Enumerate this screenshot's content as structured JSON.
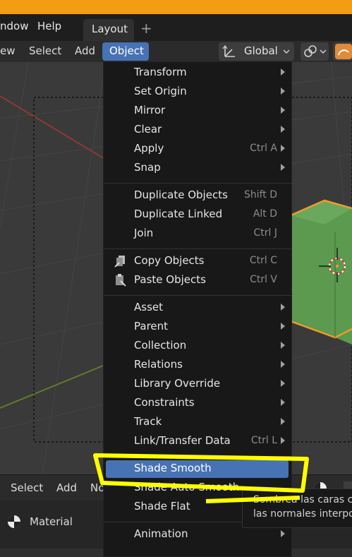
{
  "topbar": {
    "menus": [
      "ndow",
      "Help"
    ],
    "workspace_tab": "Layout",
    "add_tab_glyph": "+"
  },
  "viewport_header": {
    "menus": [
      "ew",
      "Select",
      "Add",
      "Object"
    ],
    "orientation": "Global"
  },
  "object_menu": {
    "items": [
      {
        "label": "Transform",
        "shortcut": "",
        "submenu": true
      },
      {
        "label": "Set Origin",
        "shortcut": "",
        "submenu": true
      },
      {
        "label": "Mirror",
        "shortcut": "",
        "submenu": true
      },
      {
        "label": "Clear",
        "shortcut": "",
        "submenu": true
      },
      {
        "label": "Apply",
        "shortcut": "Ctrl A",
        "submenu": true
      },
      {
        "label": "Snap",
        "shortcut": "",
        "submenu": true
      },
      {
        "label": "Duplicate Objects",
        "shortcut": "Shift D",
        "submenu": false
      },
      {
        "label": "Duplicate Linked",
        "shortcut": "Alt D",
        "submenu": false
      },
      {
        "label": "Join",
        "shortcut": "Ctrl J",
        "submenu": false
      },
      {
        "label": "Copy Objects",
        "shortcut": "Ctrl C",
        "submenu": false
      },
      {
        "label": "Paste Objects",
        "shortcut": "Ctrl V",
        "submenu": false
      },
      {
        "label": "Asset",
        "shortcut": "",
        "submenu": true
      },
      {
        "label": "Parent",
        "shortcut": "",
        "submenu": true
      },
      {
        "label": "Collection",
        "shortcut": "",
        "submenu": true
      },
      {
        "label": "Relations",
        "shortcut": "",
        "submenu": true
      },
      {
        "label": "Library Override",
        "shortcut": "",
        "submenu": true
      },
      {
        "label": "Constraints",
        "shortcut": "",
        "submenu": true
      },
      {
        "label": "Track",
        "shortcut": "",
        "submenu": true
      },
      {
        "label": "Link/Transfer Data",
        "shortcut": "Ctrl L",
        "submenu": true
      },
      {
        "label": "Shade Smooth",
        "shortcut": "",
        "submenu": false
      },
      {
        "label": "Shade Auto Smooth",
        "shortcut": "",
        "submenu": false
      },
      {
        "label": "Shade Flat",
        "shortcut": "",
        "submenu": false
      },
      {
        "label": "Animation",
        "shortcut": "",
        "submenu": true
      }
    ]
  },
  "bottom_header": {
    "menus": [
      "Select",
      "Add",
      "No"
    ]
  },
  "bottom_panel": {
    "material_label": "Material"
  },
  "tooltip": {
    "line1": "Sombrea las caras c",
    "line2": "las normales interpo"
  },
  "colors": {
    "accent": "#4772b3",
    "highlight_annotation": "#ffff00",
    "cube": "#5b9a4f",
    "title_strip": "#f39d12"
  }
}
